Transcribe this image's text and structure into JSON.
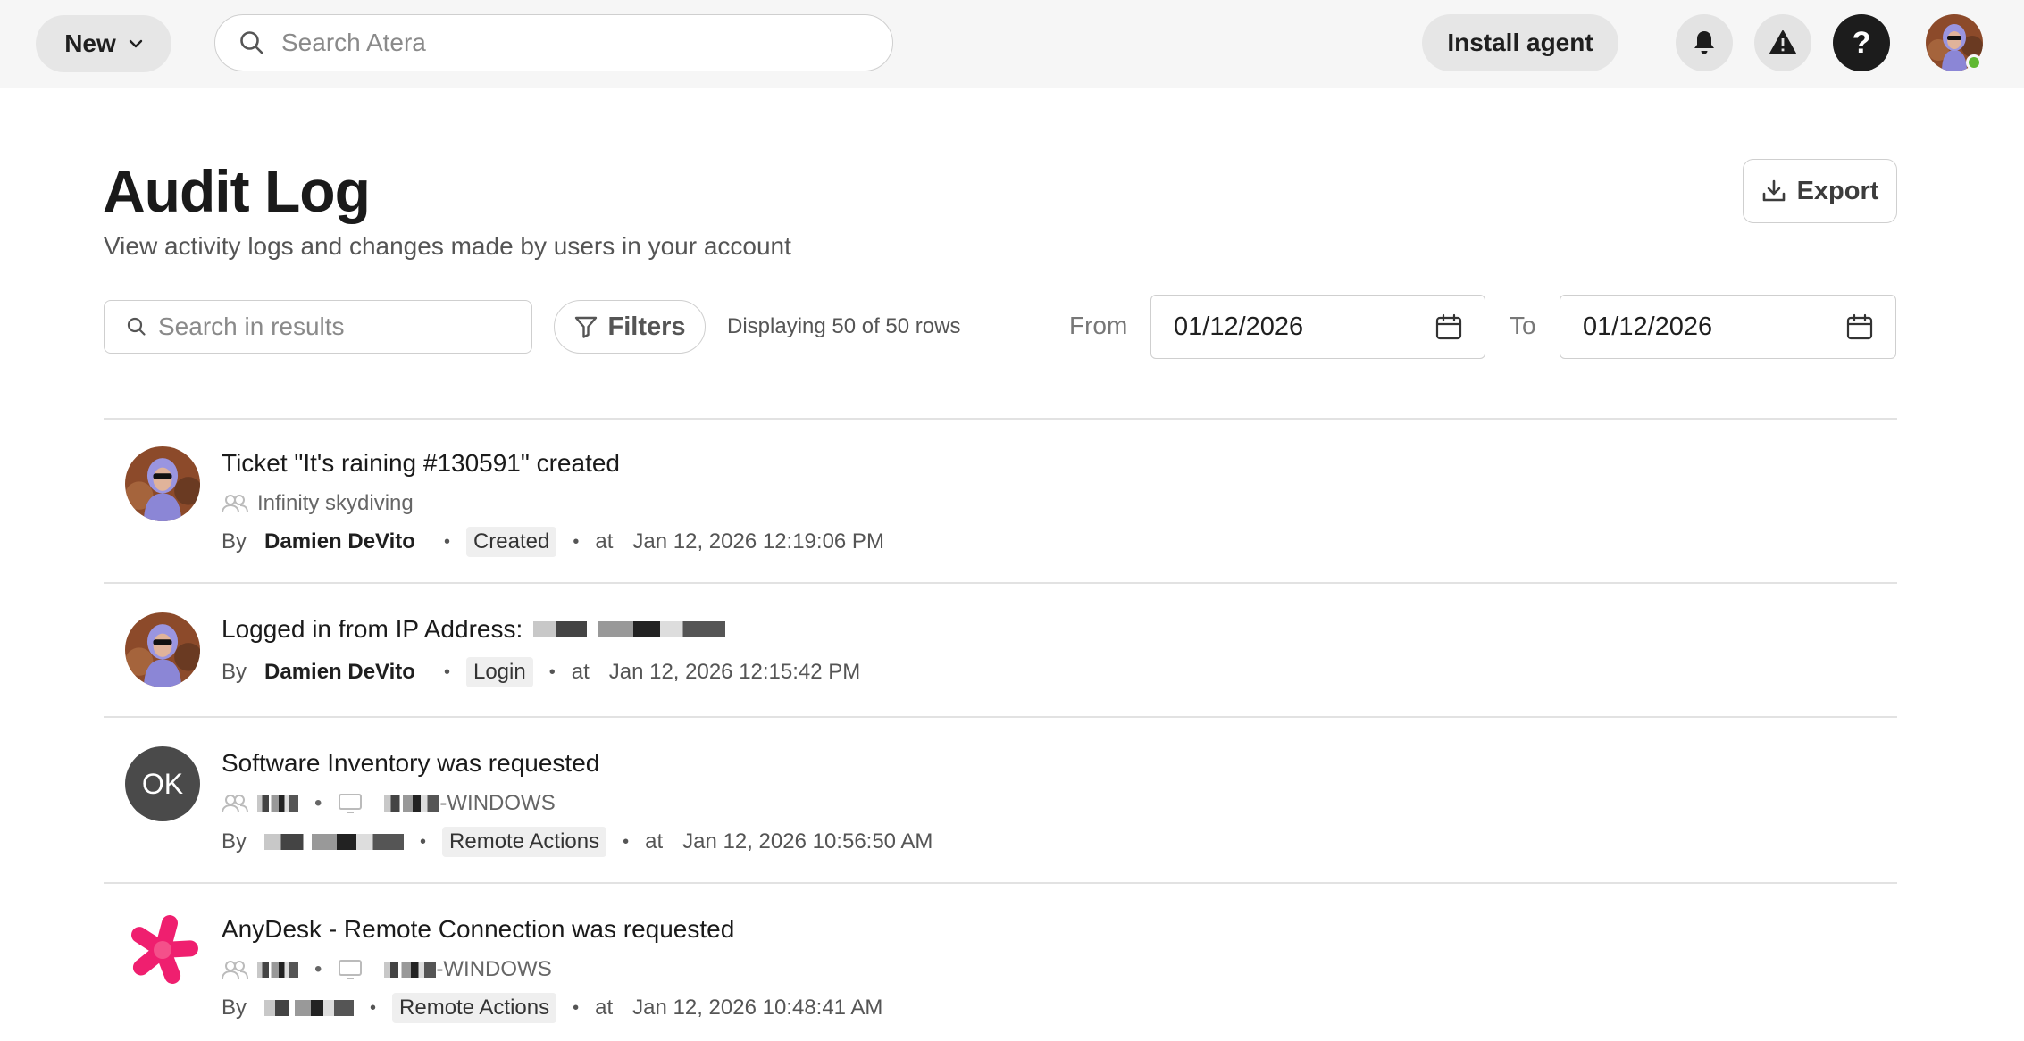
{
  "topbar": {
    "new_label": "New",
    "search_placeholder": "Search Atera",
    "install_agent_label": "Install agent",
    "help_label": "?"
  },
  "header": {
    "title": "Audit Log",
    "subtitle": "View activity logs and changes made by users in your account",
    "export_label": "Export"
  },
  "toolbar": {
    "search_placeholder": "Search in results",
    "filters_label": "Filters",
    "row_count": "Displaying 50 of 50 rows",
    "from_label": "From",
    "from_date": "01/12/2026",
    "to_label": "To",
    "to_date": "01/12/2026"
  },
  "entries": [
    {
      "title": "Ticket \"It's raining #130591\" created",
      "customer": "Infinity skydiving",
      "by_label": "By",
      "user": "Damien DeVito",
      "action": "Created",
      "at_label": "at",
      "timestamp": "Jan 12, 2026 12:19:06 PM"
    },
    {
      "title": "Logged in from IP Address:",
      "by_label": "By",
      "user": "Damien DeVito",
      "action": "Login",
      "at_label": "at",
      "timestamp": "Jan 12, 2026 12:15:42 PM"
    },
    {
      "title": "Software Inventory was requested",
      "avatar_initials": "OK",
      "device_suffix": "-WINDOWS",
      "by_label": "By",
      "action": "Remote Actions",
      "at_label": "at",
      "timestamp": "Jan 12, 2026 10:56:50 AM"
    },
    {
      "title": "AnyDesk - Remote Connection was requested",
      "device_suffix": "-WINDOWS",
      "by_label": "By",
      "action": "Remote Actions",
      "at_label": "at",
      "timestamp": "Jan 12, 2026 10:48:41 AM"
    }
  ],
  "colors": {
    "online_status": "#5fb832",
    "anydesk_brand": "#ef1f6f",
    "dark_button": "#1c1c1c"
  },
  "icons": [
    "chevron-down-icon",
    "search-icon",
    "bell-icon",
    "warning-icon",
    "download-icon",
    "filter-icon",
    "calendar-icon",
    "users-icon",
    "monitor-icon"
  ]
}
